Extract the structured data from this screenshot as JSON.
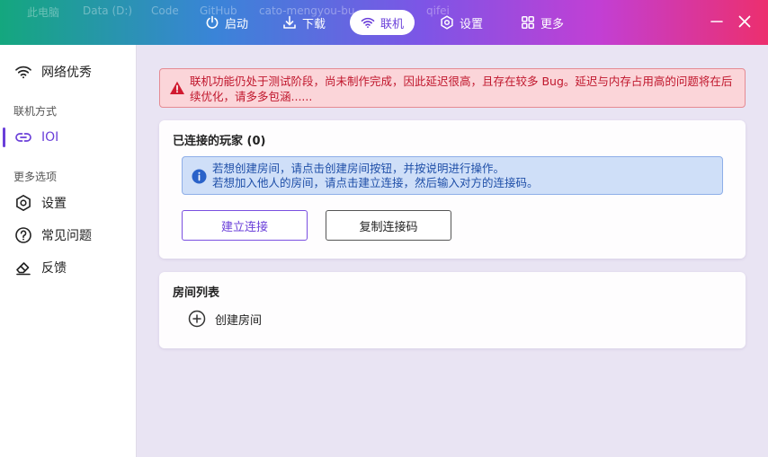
{
  "breadcrumbs": [
    "此电脑",
    "Data (D:)",
    "Code",
    "GitHub",
    "cato-mengyou-bu...",
    "...",
    "qifei"
  ],
  "nav": [
    {
      "label": "启动",
      "icon": "power-icon"
    },
    {
      "label": "下载",
      "icon": "download-icon"
    },
    {
      "label": "联机",
      "icon": "wifi-icon",
      "active": true
    },
    {
      "label": "设置",
      "icon": "settings-icon"
    },
    {
      "label": "更多",
      "icon": "grid-icon"
    }
  ],
  "sidebar": {
    "top_item": "网络优秀",
    "section1": "联机方式",
    "ioi": "IOI",
    "section2": "更多选项",
    "settings": "设置",
    "faq": "常见问题",
    "feedback": "反馈"
  },
  "warning": "联机功能仍处于测试阶段，尚未制作完成，因此延迟很高，且存在较多 Bug。延迟与内存占用高的问题将在后续优化，请多多包涵......",
  "players_card": {
    "title": "已连接的玩家 (0)",
    "info_line1": "若想创建房间，请点击创建房间按钮，并按说明进行操作。",
    "info_line2": "若想加入他人的房间，请点击建立连接，然后输入对方的连接码。",
    "connect_button": "建立连接",
    "copy_button": "复制连接码"
  },
  "rooms_card": {
    "title": "房间列表",
    "create_room": "创建房间"
  },
  "colors": {
    "accent": "#6a3fd9",
    "warning_text": "#c0162c",
    "info_text": "#1f4fa8"
  }
}
